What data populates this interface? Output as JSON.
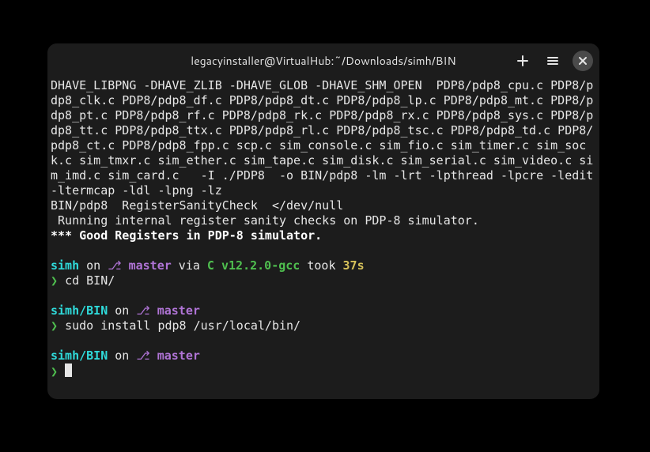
{
  "window": {
    "title": "legacyinstaller@VirtualHub:~/Downloads/simh/BIN"
  },
  "output": {
    "compile": "DHAVE_LIBPNG -DHAVE_ZLIB -DHAVE_GLOB -DHAVE_SHM_OPEN  PDP8/pdp8_cpu.c PDP8/pdp8_clk.c PDP8/pdp8_df.c PDP8/pdp8_dt.c PDP8/pdp8_lp.c PDP8/pdp8_mt.c PDP8/pdp8_pt.c PDP8/pdp8_rf.c PDP8/pdp8_rk.c PDP8/pdp8_rx.c PDP8/pdp8_sys.c PDP8/pdp8_tt.c PDP8/pdp8_ttx.c PDP8/pdp8_rl.c PDP8/pdp8_tsc.c PDP8/pdp8_td.c PDP8/pdp8_ct.c PDP8/pdp8_fpp.c scp.c sim_console.c sim_fio.c sim_timer.c sim_sock.c sim_tmxr.c sim_ether.c sim_tape.c sim_disk.c sim_serial.c sim_video.c sim_imd.c sim_card.c   -I ./PDP8  -o BIN/pdp8 -lm -lrt -lpthread -lpcre -ledit -ltermcap -ldl -lpng -lz",
    "sanity1": "BIN/pdp8  RegisterSanityCheck  </dev/null",
    "sanity2": " Running internal register sanity checks on PDP-8 simulator.",
    "sanity3": "*** Good Registers in PDP-8 simulator."
  },
  "prompt1": {
    "dir": "simh",
    "on": " on ",
    "branch_glyph": "⎇ ",
    "branch": "master",
    "via": " via ",
    "lang": "C v12.2.0-gcc",
    "took": " took ",
    "time": "37s",
    "sym": "❯ ",
    "cmd": "cd BIN/"
  },
  "prompt2": {
    "dir": "simh/BIN",
    "on": " on ",
    "branch_glyph": "⎇ ",
    "branch": "master",
    "sym": "❯ ",
    "cmd": "sudo install pdp8 /usr/local/bin/"
  },
  "prompt3": {
    "dir": "simh/BIN",
    "on": " on ",
    "branch_glyph": "⎇ ",
    "branch": "master",
    "sym": "❯ "
  }
}
